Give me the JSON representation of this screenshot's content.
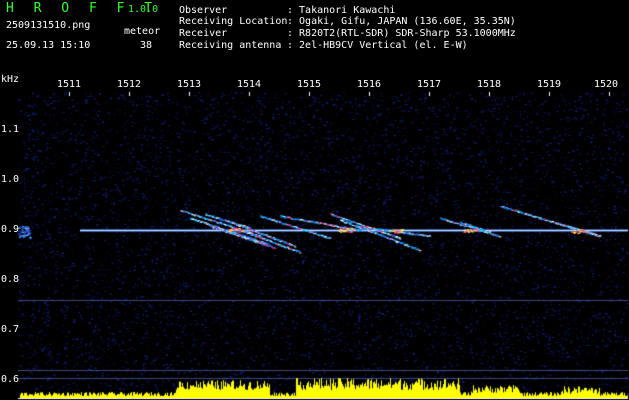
{
  "header": {
    "app_title": "H R O F F T",
    "version": "1.0.0",
    "file_name": "2509131510.png",
    "timestamp": "25.09.13 15:10",
    "meteor_label": "meteor",
    "meteor_count": "38"
  },
  "info": [
    {
      "key": "Observer",
      "value": ": Takanori Kawachi"
    },
    {
      "key": "Receiving Location",
      "value": ": Ogaki, Gifu, JAPAN (136.60E, 35.35N)"
    },
    {
      "key": "Receiver",
      "value": ": R820T2(RTL-SDR) SDR-Sharp 53.1000MHz"
    },
    {
      "key": "Receiving antenna",
      "value": ": 2el-HB9CV Vertical (el. E-W)"
    }
  ],
  "axis": {
    "frequency_unit": "kHz",
    "time_ticks": [
      "1511",
      "1512",
      "1513",
      "1514",
      "1515",
      "1516",
      "1517",
      "1518",
      "1519",
      "1520"
    ],
    "freq_ticks": [
      "1.1",
      "1.0",
      "0.9",
      "0.8",
      "0.7",
      "0.6"
    ]
  },
  "colors": {
    "title": "#33ff33",
    "text": "#ffffff",
    "background": "#000000",
    "noise": "#1a2a7a",
    "echo_hot": "#ff3366",
    "echo_mid": "#00ccff",
    "level_bar": "#ffff00",
    "carrier": "#cfe8ff"
  }
}
